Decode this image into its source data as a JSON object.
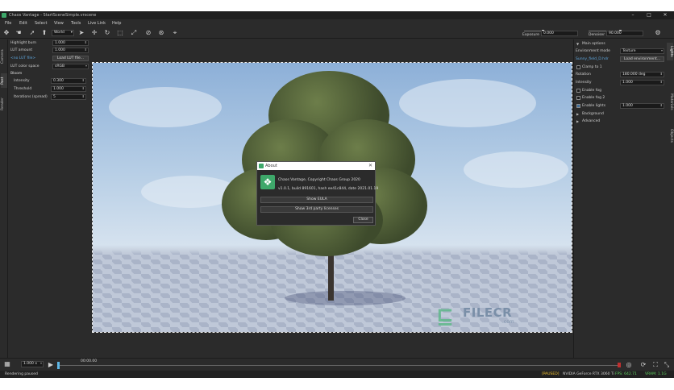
{
  "window": {
    "title": "Chaos Vantage - StartSceneSimple.vrscene",
    "controls": [
      "–",
      "□",
      "✕"
    ]
  },
  "menu": [
    "File",
    "Edit",
    "Select",
    "View",
    "Tools",
    "Live Link",
    "Help"
  ],
  "toolbar": {
    "space_select": "World",
    "exposure_label": "Exposure",
    "exposure_value": "0.000",
    "denoiser_label": "Denoiser",
    "denoiser_value": "90.000"
  },
  "left_tabs": [
    "Camera",
    "Post",
    "Render"
  ],
  "left_panel": {
    "highlight_burn_label": "Highlight burn",
    "highlight_burn_value": "1.000",
    "lut_amount_label": "LUT amount",
    "lut_amount_value": "1.000",
    "lut_file_label": "<no LUT file>",
    "load_lut_button": "Load LUT file...",
    "lut_color_space_label": "LUT color space",
    "lut_color_space_value": "sRGB",
    "bloom_header": "Bloom",
    "intensity_label": "Intensity",
    "intensity_value": "0.300",
    "threshold_label": "Threshold",
    "threshold_value": "1.000",
    "iterations_label": "Iterations (spread)",
    "iterations_value": "5"
  },
  "about_dialog": {
    "title": "About",
    "line1": "Chaos Vantage, Copyright Chaos Group 2020",
    "line2": "v1.0.1, build 891601, hash ee41c844, date 2021.01.19",
    "show_eula": "Show EULA",
    "show_licenses": "Show 3rd party licenses",
    "close": "Close"
  },
  "watermark": {
    "text": "FILECR",
    "sub": ".com"
  },
  "right_tabs": [
    "Lights",
    "Materials",
    "Objects"
  ],
  "right_panel": {
    "main_options": "Main options",
    "env_mode_label": "Environment mode",
    "env_mode_value": "Texture",
    "hdr_file": "Sunny_field_D.hdr",
    "load_env_button": "Load environment...",
    "clamp_label": "Clamp to 1",
    "rotation_label": "Rotation",
    "rotation_value": "180.000 deg",
    "intensity_label": "Intensity",
    "intensity_value": "1.000",
    "fog1_label": "Enable fog",
    "fog2_label": "Enable fog 2",
    "lights_label": "Enable lights",
    "lights_value": "1.000",
    "background_label": "Background",
    "advanced_label": "Advanced"
  },
  "timeline": {
    "speed": "1.000 x",
    "time": "00:00.00"
  },
  "status": {
    "left": "Rendering paused",
    "paused": "[PAUSED]",
    "gpu": "NVIDIA GeForce RTX 3060 Ti",
    "fps": "FPS: 642.71",
    "vram": "VRAM: 1.1G"
  },
  "colors": {
    "accent": "#3ea86a",
    "link": "#5fa8e0",
    "paused": "#f0c030",
    "fps": "#5fd060"
  }
}
